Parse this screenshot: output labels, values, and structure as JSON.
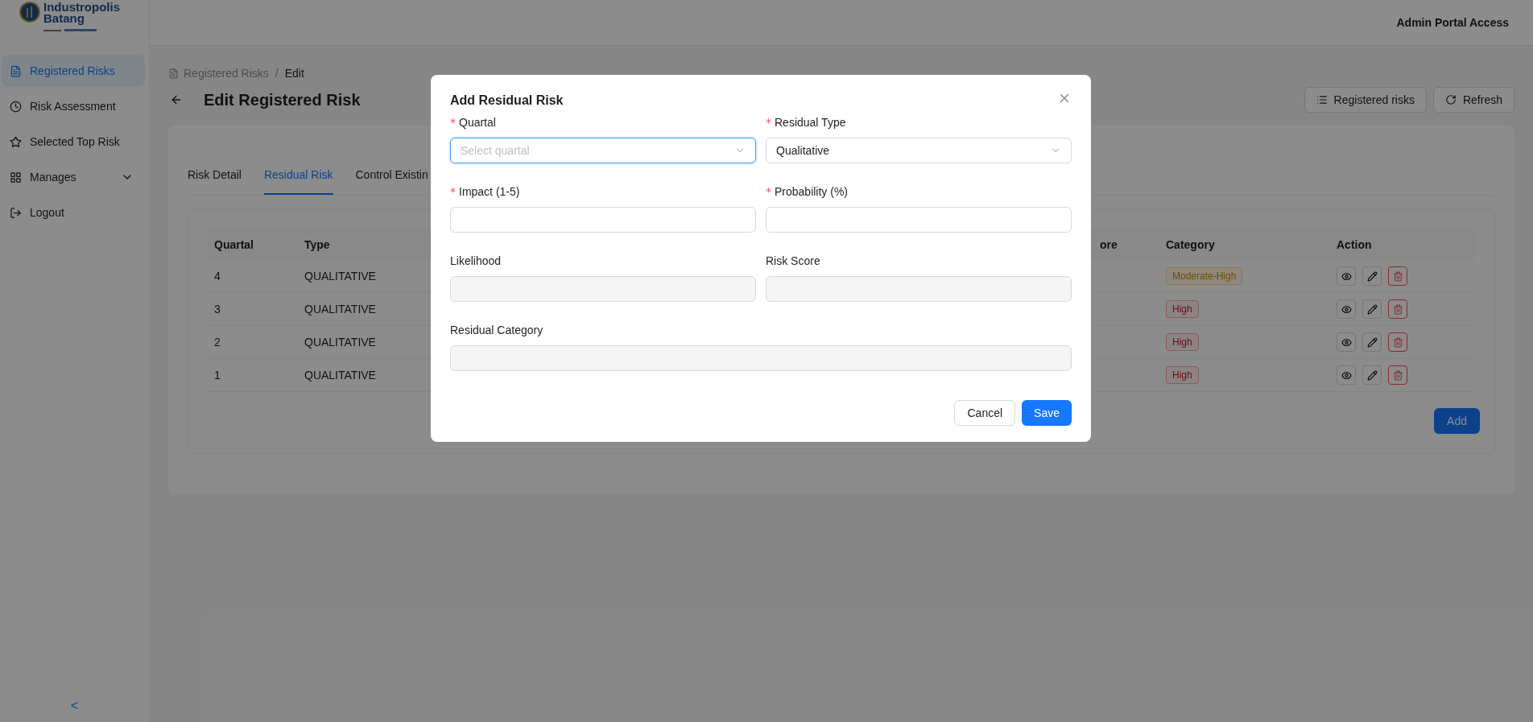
{
  "logo": {
    "line1": "Industropolis",
    "line2": "Batang"
  },
  "header": {
    "user": "Admin Portal Access"
  },
  "sidebar": {
    "items": [
      {
        "label": "Registered Risks",
        "selected": true
      },
      {
        "label": "Risk Assessment",
        "selected": false
      },
      {
        "label": "Selected Top Risk",
        "selected": false
      },
      {
        "label": "Manages",
        "selected": false,
        "expanded": false
      },
      {
        "label": "Logout",
        "selected": false
      }
    ],
    "collapse": "<"
  },
  "breadcrumb": {
    "items": [
      "Registered Risks",
      "Edit"
    ],
    "separator": "/"
  },
  "page_title": "Edit Registered Risk",
  "toolbar": [
    {
      "label": "Registered risks"
    },
    {
      "label": "Refresh"
    }
  ],
  "tabs": [
    {
      "label": "Risk Detail",
      "selected": false
    },
    {
      "label": "Residual Risk",
      "selected": true
    },
    {
      "label": "Control Existin",
      "selected": false
    }
  ],
  "table": {
    "columns": [
      "Quartal",
      "Type",
      "ore",
      "Category",
      "Action"
    ],
    "rows": [
      {
        "quartal": "4",
        "type": "QUALITATIVE",
        "category": {
          "label": "Moderate-High",
          "kind": "warning"
        }
      },
      {
        "quartal": "3",
        "type": "QUALITATIVE",
        "category": {
          "label": "High",
          "kind": "danger"
        }
      },
      {
        "quartal": "2",
        "type": "QUALITATIVE",
        "category": {
          "label": "High",
          "kind": "danger"
        }
      },
      {
        "quartal": "1",
        "type": "QUALITATIVE",
        "category": {
          "label": "High",
          "kind": "danger"
        }
      }
    ]
  },
  "add_button": "Add",
  "dialog": {
    "title": "Add Residual Risk",
    "required_mark": "*",
    "fields": [
      {
        "label": "Quartal",
        "required": true,
        "kind": "select",
        "placeholder": "Select quartal",
        "focused": true
      },
      {
        "label": "Residual Type",
        "required": true,
        "kind": "select",
        "value": "Qualitative",
        "focused": false
      },
      {
        "label": "Impact (1-5)",
        "required": true,
        "kind": "input",
        "focused": false
      },
      {
        "label": "Probability (%)",
        "required": true,
        "kind": "input",
        "focused": false
      },
      {
        "label": "Likelihood",
        "required": false,
        "kind": "readonly",
        "focused": false
      },
      {
        "label": "Risk Score",
        "required": false,
        "kind": "readonly",
        "focused": false
      },
      {
        "label": "Residual Category",
        "required": false,
        "kind": "readonly",
        "wide": true,
        "focused": false
      }
    ],
    "buttons": [
      {
        "label": "Cancel",
        "kind": "secondary"
      },
      {
        "label": "Save",
        "kind": "primary"
      }
    ]
  }
}
